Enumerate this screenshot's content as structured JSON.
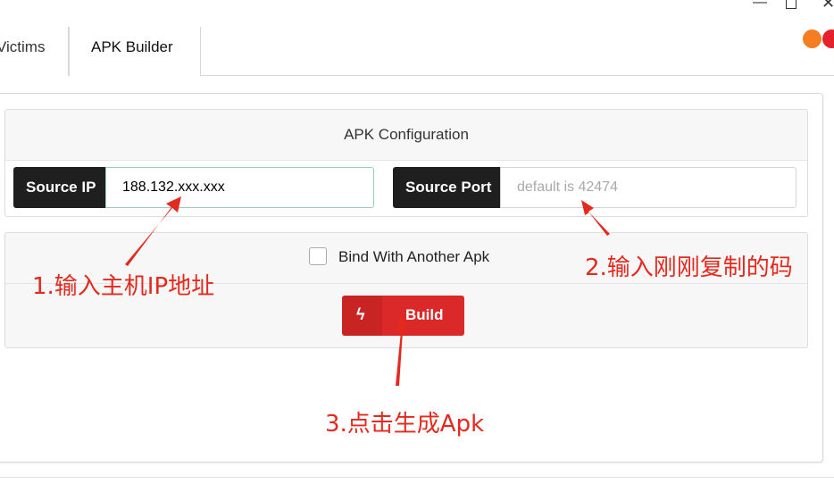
{
  "window": {
    "minimize_glyph": "—",
    "close_glyph": "✕"
  },
  "tabs": [
    {
      "label": "Victims"
    },
    {
      "label": "APK Builder"
    }
  ],
  "status_dots": {
    "colors": [
      "#f57f20",
      "#e5212b"
    ]
  },
  "config": {
    "title": "APK Configuration",
    "source_ip": {
      "label": "Source IP",
      "value": "188.132.xxx.xxx"
    },
    "source_port": {
      "label": "Source Port",
      "placeholder": "default is 42474"
    }
  },
  "bind": {
    "label": "Bind With Another Apk",
    "checked": false
  },
  "build_button": {
    "label": "Build",
    "icon": "lightning-icon",
    "color": "#db2828"
  },
  "annotations": {
    "note1": "1.输入主机IP地址",
    "note2": "2.输入刚刚复制的码",
    "note3": "3.点击生成Apk",
    "color": "#e42a1f"
  }
}
